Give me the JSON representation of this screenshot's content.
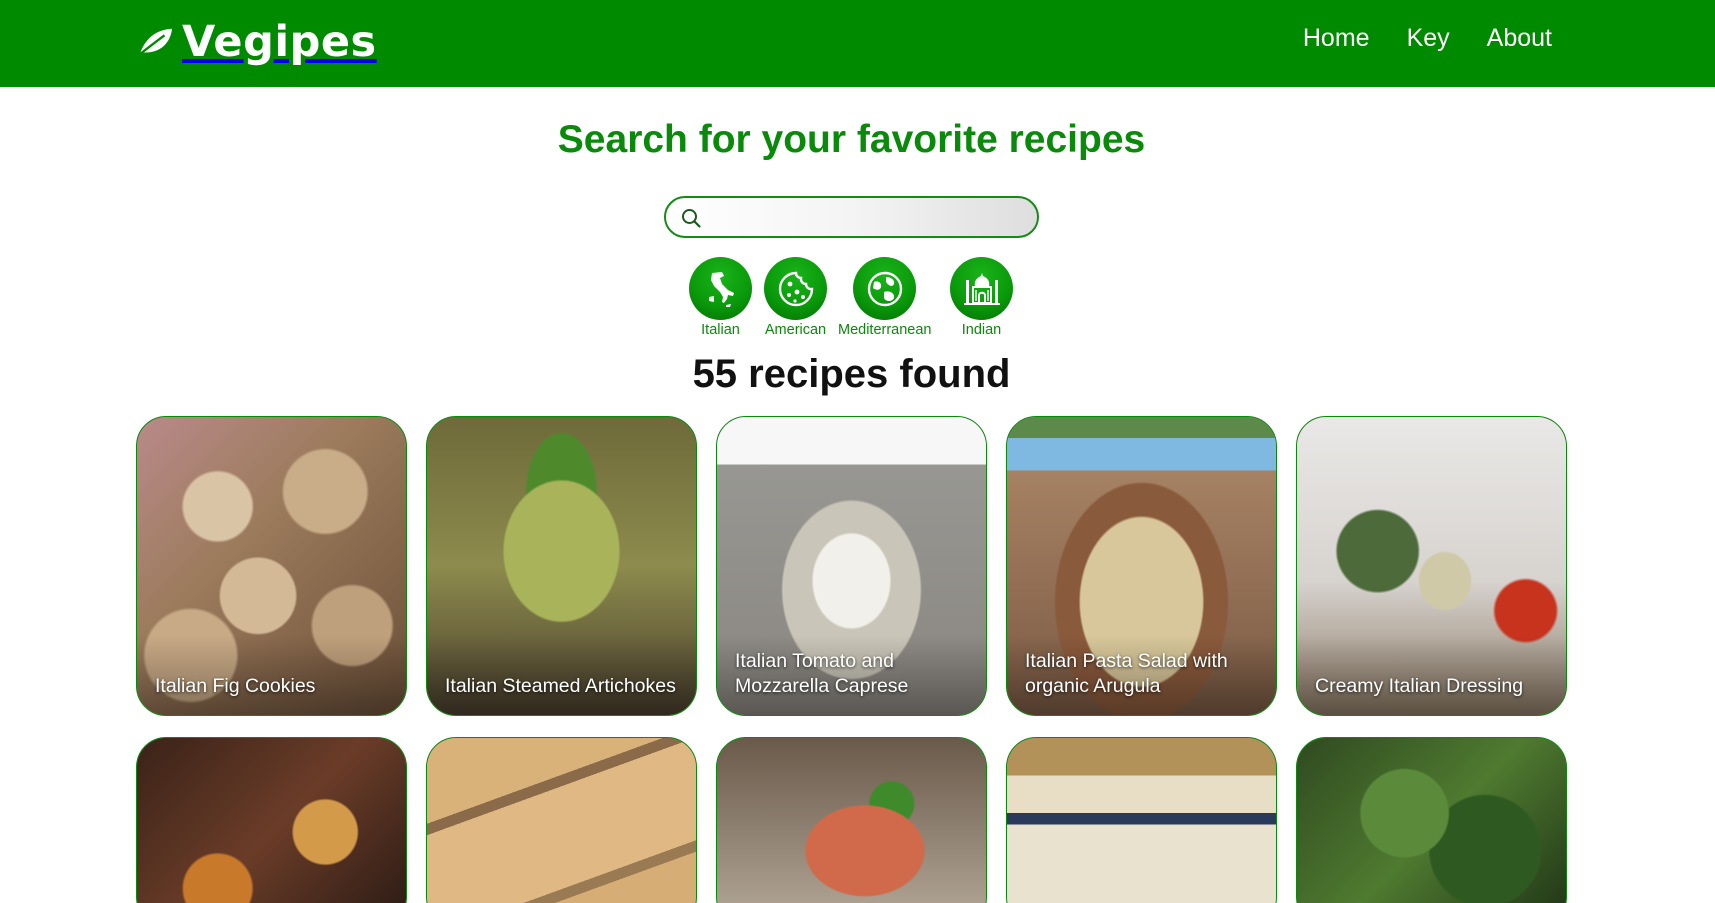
{
  "brand": {
    "name": "Vegipes"
  },
  "nav": {
    "home": "Home",
    "key": "Key",
    "about": "About"
  },
  "search": {
    "heading": "Search for your favorite recipes",
    "placeholder": "",
    "value": ""
  },
  "filters": [
    {
      "label": "Italian",
      "icon": "italy-map-icon"
    },
    {
      "label": "American",
      "icon": "cookie-icon"
    },
    {
      "label": "Mediterranean",
      "icon": "globe-icon"
    },
    {
      "label": "Indian",
      "icon": "taj-mahal-icon"
    }
  ],
  "results": {
    "count_text": "55 recipes found"
  },
  "recipes": [
    {
      "title": "Italian Fig Cookies"
    },
    {
      "title": "Italian Steamed Artichokes"
    },
    {
      "title": "Italian Tomato and Mozzarella Caprese"
    },
    {
      "title": "Italian Pasta Salad with organic Arugula"
    },
    {
      "title": "Creamy Italian Dressing"
    },
    {
      "title": ""
    },
    {
      "title": ""
    },
    {
      "title": ""
    },
    {
      "title": ""
    },
    {
      "title": ""
    }
  ],
  "colors": {
    "brand_green": "#008a00",
    "text_green": "#0a8a0a",
    "white": "#ffffff"
  }
}
